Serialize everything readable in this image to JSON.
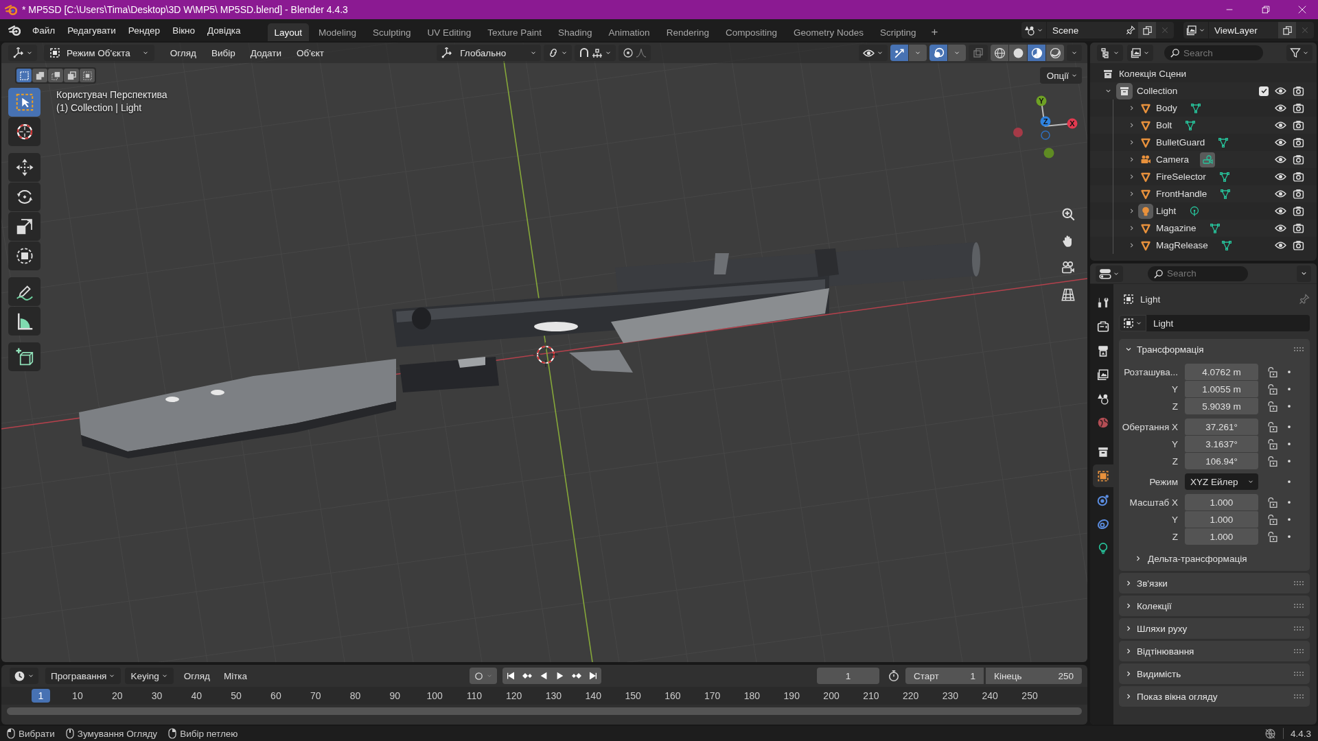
{
  "window": {
    "title": "* MP5SD [C:\\Users\\Tima\\Desktop\\3D W\\MP5\\ MP5SD.blend] - Blender 4.4.3"
  },
  "menus": [
    "Файл",
    "Редагувати",
    "Рендер",
    "Вікно",
    "Довідка"
  ],
  "workspace_tabs": [
    {
      "label": "Layout",
      "selected": true
    },
    {
      "label": "Modeling",
      "selected": false
    },
    {
      "label": "Sculpting",
      "selected": false
    },
    {
      "label": "UV Editing",
      "selected": false
    },
    {
      "label": "Texture Paint",
      "selected": false
    },
    {
      "label": "Shading",
      "selected": false
    },
    {
      "label": "Animation",
      "selected": false
    },
    {
      "label": "Rendering",
      "selected": false
    },
    {
      "label": "Compositing",
      "selected": false
    },
    {
      "label": "Geometry Nodes",
      "selected": false
    },
    {
      "label": "Scripting",
      "selected": false
    }
  ],
  "add_tab": "+",
  "scene": {
    "name": "Scene"
  },
  "view_layer": {
    "name": "ViewLayer"
  },
  "viewport": {
    "mode": "Режим Об'єкта",
    "menus": [
      "Огляд",
      "Вибір",
      "Додати",
      "Об'єкт"
    ],
    "orientation": "Глобально",
    "select_modes": [
      {
        "kind": "new",
        "selected": true
      },
      {
        "kind": "extend",
        "selected": false
      },
      {
        "kind": "subtract",
        "selected": false
      },
      {
        "kind": "invert",
        "selected": false
      },
      {
        "kind": "intersect",
        "selected": false
      }
    ],
    "gizmos_on": true,
    "overlays_on": true,
    "shading": [
      {
        "kind": "wireframe",
        "selected": false
      },
      {
        "kind": "solid",
        "selected": false
      },
      {
        "kind": "material",
        "selected": true
      },
      {
        "kind": "rendered",
        "selected": false
      }
    ],
    "options": "Опції",
    "view_name": "Користувач Перспектива",
    "context": "(1) Collection | Light",
    "tools": [
      {
        "kind": "select",
        "selected": true
      },
      {
        "kind": "cursor",
        "selected": false
      },
      {
        "kind": "move",
        "selected": false
      },
      {
        "kind": "rotate",
        "selected": false
      },
      {
        "kind": "scale",
        "selected": false
      },
      {
        "kind": "transform",
        "selected": false
      },
      {
        "kind": "annotate",
        "selected": false
      },
      {
        "kind": "measure",
        "selected": false
      },
      {
        "kind": "add_cube",
        "selected": false
      }
    ],
    "axes": [
      {
        "label": "Y",
        "color": "#6ea124"
      },
      {
        "label": "Z",
        "color": "#2f83e0"
      },
      {
        "label": "X",
        "color": "#e23a50"
      }
    ]
  },
  "timeline": {
    "menus": [
      "Програвання",
      "Keying",
      "Огляд",
      "Мітка"
    ],
    "current_frame": "1",
    "start_label": "Старт",
    "start": "1",
    "end_label": "Кінець",
    "end": "250",
    "ruler": [
      {
        "label": "1",
        "selected": true
      },
      {
        "label": "10",
        "selected": false
      },
      {
        "label": "20",
        "selected": false
      },
      {
        "label": "30",
        "selected": false
      },
      {
        "label": "40",
        "selected": false
      },
      {
        "label": "50",
        "selected": false
      },
      {
        "label": "60",
        "selected": false
      },
      {
        "label": "70",
        "selected": false
      },
      {
        "label": "80",
        "selected": false
      },
      {
        "label": "90",
        "selected": false
      },
      {
        "label": "100",
        "selected": false
      },
      {
        "label": "110",
        "selected": false
      },
      {
        "label": "120",
        "selected": false
      },
      {
        "label": "130",
        "selected": false
      },
      {
        "label": "140",
        "selected": false
      },
      {
        "label": "150",
        "selected": false
      },
      {
        "label": "160",
        "selected": false
      },
      {
        "label": "170",
        "selected": false
      },
      {
        "label": "180",
        "selected": false
      },
      {
        "label": "190",
        "selected": false
      },
      {
        "label": "200",
        "selected": false
      },
      {
        "label": "210",
        "selected": false
      },
      {
        "label": "220",
        "selected": false
      },
      {
        "label": "230",
        "selected": false
      },
      {
        "label": "240",
        "selected": false
      },
      {
        "label": "250",
        "selected": false
      }
    ]
  },
  "outliner": {
    "search": {
      "placeholder": "Search"
    },
    "scene_collection": "Колекція Сцени",
    "collection": {
      "name": "Collection",
      "expanded": true,
      "checked": true,
      "children": [
        {
          "name": "Body",
          "kind": "mesh",
          "expanded": false,
          "active": false,
          "data_active": false,
          "visible": true
        },
        {
          "name": "Bolt",
          "kind": "mesh",
          "expanded": false,
          "active": false,
          "data_active": false,
          "visible": true
        },
        {
          "name": "BulletGuard",
          "kind": "mesh",
          "expanded": false,
          "active": false,
          "data_active": false,
          "visible": true
        },
        {
          "name": "Camera",
          "kind": "camera",
          "expanded": false,
          "active": false,
          "data_active": true,
          "visible": true
        },
        {
          "name": "FireSelector",
          "kind": "mesh",
          "expanded": false,
          "active": false,
          "data_active": false,
          "visible": true
        },
        {
          "name": "FrontHandle",
          "kind": "mesh",
          "expanded": false,
          "active": false,
          "data_active": false,
          "visible": true
        },
        {
          "name": "Light",
          "kind": "light",
          "expanded": false,
          "active": true,
          "data_active": false,
          "visible": true
        },
        {
          "name": "Magazine",
          "kind": "mesh",
          "expanded": false,
          "active": false,
          "data_active": false,
          "visible": true
        },
        {
          "name": "MagRelease",
          "kind": "mesh",
          "expanded": false,
          "active": false,
          "data_active": false,
          "visible": true
        }
      ]
    }
  },
  "properties": {
    "search": {
      "placeholder": "Search"
    },
    "tabs": [
      {
        "kind": "tool",
        "selected": false
      },
      {
        "kind": "render",
        "selected": false
      },
      {
        "kind": "output",
        "selected": false
      },
      {
        "kind": "view_layer",
        "selected": false
      },
      {
        "kind": "scene",
        "selected": false
      },
      {
        "kind": "world",
        "selected": false
      },
      {
        "kind": "collection",
        "selected": false
      },
      {
        "kind": "object",
        "selected": true
      },
      {
        "kind": "physics",
        "selected": false
      },
      {
        "kind": "constraints",
        "selected": false
      },
      {
        "kind": "data",
        "selected": false
      }
    ],
    "object_name": "Light",
    "data_name": "Light",
    "transform": {
      "title": "Трансформація",
      "expanded": true,
      "groups": [
        {
          "kind": "fields",
          "rows": [
            {
              "label": "Розташува...",
              "value": "4.0762 m"
            },
            {
              "label": "Y",
              "value": "1.0055 m"
            },
            {
              "label": "Z",
              "value": "5.9039 m"
            }
          ]
        },
        {
          "kind": "fields",
          "rows": [
            {
              "label": "Обертання X",
              "value": "37.261°"
            },
            {
              "label": "Y",
              "value": "3.1637°"
            },
            {
              "label": "Z",
              "value": "106.94°"
            }
          ]
        },
        {
          "kind": "dropdown",
          "label": "Режим",
          "value": "XYZ Ейлер"
        },
        {
          "kind": "fields",
          "rows": [
            {
              "label": "Масштаб X",
              "value": "1.000"
            },
            {
              "label": "Y",
              "value": "1.000"
            },
            {
              "label": "Z",
              "value": "1.000"
            }
          ]
        }
      ],
      "delta": {
        "title": "Дельта-трансформація",
        "expanded": false
      }
    },
    "panels": [
      {
        "title": "Зв'язки",
        "expanded": false
      },
      {
        "title": "Колекції",
        "expanded": false
      },
      {
        "title": "Шляхи руху",
        "expanded": false
      },
      {
        "title": "Відтінювання",
        "expanded": false
      },
      {
        "title": "Видимість",
        "expanded": false
      },
      {
        "title": "Показ вікна огляду",
        "expanded": false
      }
    ]
  },
  "status_bar": {
    "hints": [
      "Вибрати",
      "Зумування Огляду",
      "Вибір петлею"
    ],
    "version": "4.4.3"
  }
}
